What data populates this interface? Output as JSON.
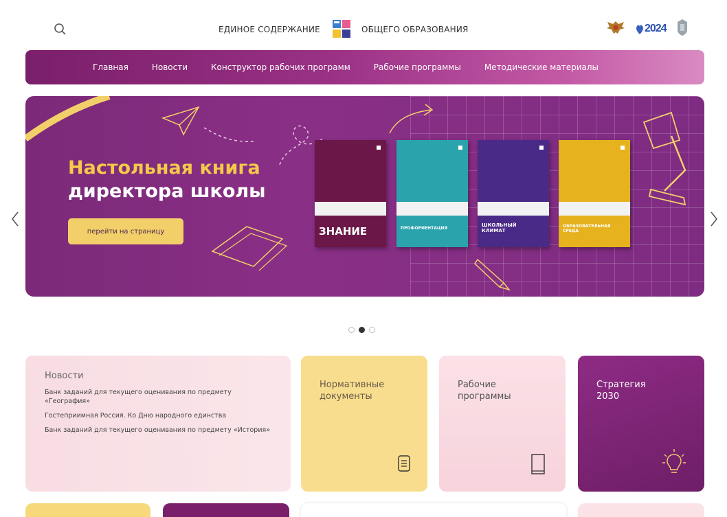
{
  "header": {
    "title_left": "ЕДИНОЕ СОДЕРЖАНИЕ",
    "title_right": "ОБЩЕГО ОБРАЗОВАНИЯ",
    "year_badge": "2024",
    "icons": [
      "search-icon",
      "site-logo",
      "eagle-emblem",
      "year-2024-logo",
      "ministry-emblem"
    ]
  },
  "nav": {
    "items": [
      "Главная",
      "Новости",
      "Конструктор рабочих программ",
      "Рабочие программы",
      "Методические материалы"
    ]
  },
  "banner": {
    "title_line1": "Настольная книга",
    "title_line2": "директора школы",
    "button": "перейти на страницу",
    "books": [
      {
        "title": "ЗНАНИЕ",
        "color": "#6b1747"
      },
      {
        "title": "ПРОФОРИЕНТАЦИЯ",
        "color": "#2aa3ad"
      },
      {
        "title": "ШКОЛЬНЫЙ КЛИМАТ",
        "color": "#4a2a87"
      },
      {
        "title": "ОБРАЗОВАТЕЛЬНАЯ СРЕДА",
        "color": "#e6b21e"
      }
    ],
    "slider_total": 3,
    "slider_active": 2
  },
  "news": {
    "heading": "Новости",
    "items": [
      "Банк заданий для текущего оценивания по предмету «География»",
      "Гостеприимная Россия. Ко Дню народного единства",
      "Банк заданий для текущего оценивания по предмету «История»"
    ]
  },
  "tiles": {
    "normative": "Нормативные документы",
    "programs": "Рабочие программы",
    "strategy": "Стратегия 2030"
  },
  "colors": {
    "accent_purple": "#7a1f6a",
    "accent_yellow": "#f3cf6a",
    "accent_pink": "#f8dde3"
  }
}
